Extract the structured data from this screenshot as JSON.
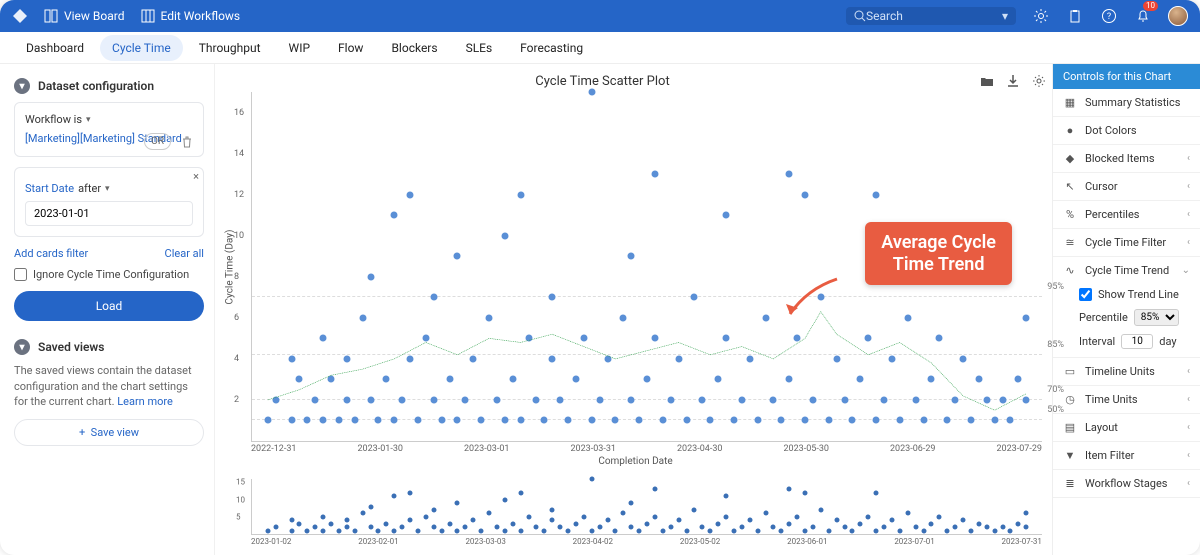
{
  "topbar": {
    "view_board": "View Board",
    "edit_workflows": "Edit Workflows",
    "search_placeholder": "Search",
    "notification_count": "10"
  },
  "tabs": [
    "Dashboard",
    "Cycle Time",
    "Throughput",
    "WIP",
    "Flow",
    "Blockers",
    "SLEs",
    "Forecasting"
  ],
  "active_tab": 1,
  "left": {
    "dataset_header": "Dataset configuration",
    "workflow_label": "Workflow is",
    "workflow_chips": "[Marketing][Marketing] Standard",
    "or": "OR",
    "start_date_label": "Start Date",
    "after": "after",
    "start_date_value": "2023-01-01",
    "add_filter": "Add cards filter",
    "clear_all": "Clear all",
    "ignore_config": "Ignore Cycle Time Configuration",
    "load": "Load",
    "saved_views_header": "Saved views",
    "saved_views_text": "The saved views contain the dataset configuration and the chart settings for the current chart.",
    "learn_more": "Learn more",
    "save_view": "Save view"
  },
  "chart": {
    "title": "Cycle Time Scatter Plot",
    "ylabel": "Cycle Time (Day)",
    "xlabel": "Completion Date",
    "callout": "Average Cycle\nTime Trend"
  },
  "right": {
    "header": "Controls for this Chart",
    "summary": "Summary Statistics",
    "dot_colors": "Dot Colors",
    "blocked": "Blocked Items",
    "cursor": "Cursor",
    "percentiles": "Percentiles",
    "ct_filter": "Cycle Time Filter",
    "ct_trend": "Cycle Time Trend",
    "show_trend": "Show Trend Line",
    "percentile_label": "Percentile",
    "percentile_value": "85%",
    "interval_label": "Interval",
    "interval_value": "10",
    "interval_unit": "day",
    "timeline_units": "Timeline Units",
    "time_units": "Time Units",
    "layout": "Layout",
    "item_filter": "Item Filter",
    "workflow_stages": "Workflow Stages"
  },
  "chart_data": {
    "type": "scatter",
    "title": "Cycle Time Scatter Plot",
    "xlabel": "Completion Date",
    "ylabel": "Cycle Time (Day)",
    "ylim": [
      0,
      17
    ],
    "yticks": [
      2,
      4,
      6,
      8,
      10,
      12,
      14,
      16
    ],
    "x_ticks": [
      "2022-12-31",
      "2023-01-30",
      "2023-03-01",
      "2023-03-31",
      "2023-04-30",
      "2023-05-30",
      "2023-06-29",
      "2023-07-29"
    ],
    "percentile_lines": [
      {
        "label": "95%",
        "y": 7
      },
      {
        "label": "85%",
        "y": 4.2
      },
      {
        "label": "70%",
        "y": 2
      },
      {
        "label": "50%",
        "y": 1
      }
    ],
    "trend_series": {
      "name": "Average Cycle Time Trend",
      "x_frac": [
        0.02,
        0.06,
        0.1,
        0.14,
        0.18,
        0.22,
        0.26,
        0.3,
        0.34,
        0.38,
        0.42,
        0.46,
        0.5,
        0.54,
        0.58,
        0.62,
        0.66,
        0.7,
        0.72,
        0.74,
        0.78,
        0.82,
        0.86,
        0.9,
        0.94,
        0.98
      ],
      "y": [
        2.0,
        2.5,
        3.2,
        3.5,
        4.0,
        4.8,
        4.2,
        5.0,
        4.8,
        5.2,
        4.6,
        4.0,
        4.4,
        4.8,
        4.2,
        4.6,
        4.0,
        5.0,
        6.3,
        5.2,
        4.2,
        4.8,
        3.8,
        2.2,
        1.5,
        2.3
      ]
    },
    "scatter_points": [
      {
        "x": 0.02,
        "y": 1
      },
      {
        "x": 0.03,
        "y": 2
      },
      {
        "x": 0.05,
        "y": 1
      },
      {
        "x": 0.05,
        "y": 4
      },
      {
        "x": 0.06,
        "y": 3
      },
      {
        "x": 0.07,
        "y": 1
      },
      {
        "x": 0.08,
        "y": 2
      },
      {
        "x": 0.09,
        "y": 1
      },
      {
        "x": 0.09,
        "y": 5
      },
      {
        "x": 0.1,
        "y": 3
      },
      {
        "x": 0.11,
        "y": 1
      },
      {
        "x": 0.12,
        "y": 2
      },
      {
        "x": 0.12,
        "y": 4
      },
      {
        "x": 0.13,
        "y": 1
      },
      {
        "x": 0.14,
        "y": 6
      },
      {
        "x": 0.15,
        "y": 2
      },
      {
        "x": 0.15,
        "y": 8
      },
      {
        "x": 0.16,
        "y": 1
      },
      {
        "x": 0.17,
        "y": 3
      },
      {
        "x": 0.18,
        "y": 1
      },
      {
        "x": 0.18,
        "y": 11
      },
      {
        "x": 0.19,
        "y": 2
      },
      {
        "x": 0.2,
        "y": 4
      },
      {
        "x": 0.2,
        "y": 12
      },
      {
        "x": 0.21,
        "y": 1
      },
      {
        "x": 0.22,
        "y": 5
      },
      {
        "x": 0.23,
        "y": 2
      },
      {
        "x": 0.23,
        "y": 7
      },
      {
        "x": 0.24,
        "y": 1
      },
      {
        "x": 0.25,
        "y": 3
      },
      {
        "x": 0.26,
        "y": 1
      },
      {
        "x": 0.26,
        "y": 9
      },
      {
        "x": 0.27,
        "y": 2
      },
      {
        "x": 0.28,
        "y": 4
      },
      {
        "x": 0.29,
        "y": 1
      },
      {
        "x": 0.3,
        "y": 6
      },
      {
        "x": 0.31,
        "y": 2
      },
      {
        "x": 0.32,
        "y": 1
      },
      {
        "x": 0.32,
        "y": 10
      },
      {
        "x": 0.33,
        "y": 3
      },
      {
        "x": 0.34,
        "y": 1
      },
      {
        "x": 0.34,
        "y": 12
      },
      {
        "x": 0.35,
        "y": 5
      },
      {
        "x": 0.36,
        "y": 2
      },
      {
        "x": 0.37,
        "y": 1
      },
      {
        "x": 0.38,
        "y": 4
      },
      {
        "x": 0.38,
        "y": 7
      },
      {
        "x": 0.39,
        "y": 2
      },
      {
        "x": 0.4,
        "y": 1
      },
      {
        "x": 0.41,
        "y": 3
      },
      {
        "x": 0.42,
        "y": 5
      },
      {
        "x": 0.43,
        "y": 17
      },
      {
        "x": 0.43,
        "y": 1
      },
      {
        "x": 0.44,
        "y": 2
      },
      {
        "x": 0.45,
        "y": 4
      },
      {
        "x": 0.46,
        "y": 1
      },
      {
        "x": 0.47,
        "y": 6
      },
      {
        "x": 0.48,
        "y": 2
      },
      {
        "x": 0.48,
        "y": 9
      },
      {
        "x": 0.49,
        "y": 1
      },
      {
        "x": 0.5,
        "y": 3
      },
      {
        "x": 0.51,
        "y": 5
      },
      {
        "x": 0.51,
        "y": 13
      },
      {
        "x": 0.52,
        "y": 1
      },
      {
        "x": 0.53,
        "y": 2
      },
      {
        "x": 0.54,
        "y": 4
      },
      {
        "x": 0.55,
        "y": 1
      },
      {
        "x": 0.56,
        "y": 7
      },
      {
        "x": 0.57,
        "y": 2
      },
      {
        "x": 0.58,
        "y": 1
      },
      {
        "x": 0.59,
        "y": 3
      },
      {
        "x": 0.6,
        "y": 5
      },
      {
        "x": 0.6,
        "y": 11
      },
      {
        "x": 0.61,
        "y": 1
      },
      {
        "x": 0.62,
        "y": 2
      },
      {
        "x": 0.63,
        "y": 4
      },
      {
        "x": 0.64,
        "y": 1
      },
      {
        "x": 0.65,
        "y": 6
      },
      {
        "x": 0.66,
        "y": 2
      },
      {
        "x": 0.67,
        "y": 1
      },
      {
        "x": 0.68,
        "y": 3
      },
      {
        "x": 0.68,
        "y": 13
      },
      {
        "x": 0.69,
        "y": 5
      },
      {
        "x": 0.7,
        "y": 1
      },
      {
        "x": 0.7,
        "y": 12
      },
      {
        "x": 0.71,
        "y": 2
      },
      {
        "x": 0.72,
        "y": 7
      },
      {
        "x": 0.73,
        "y": 1
      },
      {
        "x": 0.74,
        "y": 4
      },
      {
        "x": 0.75,
        "y": 2
      },
      {
        "x": 0.76,
        "y": 1
      },
      {
        "x": 0.77,
        "y": 3
      },
      {
        "x": 0.78,
        "y": 5
      },
      {
        "x": 0.79,
        "y": 1
      },
      {
        "x": 0.79,
        "y": 12
      },
      {
        "x": 0.8,
        "y": 2
      },
      {
        "x": 0.81,
        "y": 4
      },
      {
        "x": 0.82,
        "y": 1
      },
      {
        "x": 0.83,
        "y": 6
      },
      {
        "x": 0.84,
        "y": 2
      },
      {
        "x": 0.85,
        "y": 1
      },
      {
        "x": 0.86,
        "y": 3
      },
      {
        "x": 0.87,
        "y": 5
      },
      {
        "x": 0.88,
        "y": 1
      },
      {
        "x": 0.89,
        "y": 2
      },
      {
        "x": 0.9,
        "y": 4
      },
      {
        "x": 0.91,
        "y": 1
      },
      {
        "x": 0.92,
        "y": 3
      },
      {
        "x": 0.93,
        "y": 2
      },
      {
        "x": 0.94,
        "y": 1
      },
      {
        "x": 0.95,
        "y": 2
      },
      {
        "x": 0.96,
        "y": 1
      },
      {
        "x": 0.97,
        "y": 3
      },
      {
        "x": 0.98,
        "y": 2
      },
      {
        "x": 0.98,
        "y": 6
      }
    ],
    "overview": {
      "ylim": [
        0,
        16
      ],
      "yticks": [
        5,
        10,
        15
      ],
      "x_ticks": [
        "2023-01-02",
        "2023-02-01",
        "2023-03-03",
        "2023-04-02",
        "2023-05-02",
        "2023-06-01",
        "2023-07-01",
        "2023-07-31"
      ]
    }
  }
}
